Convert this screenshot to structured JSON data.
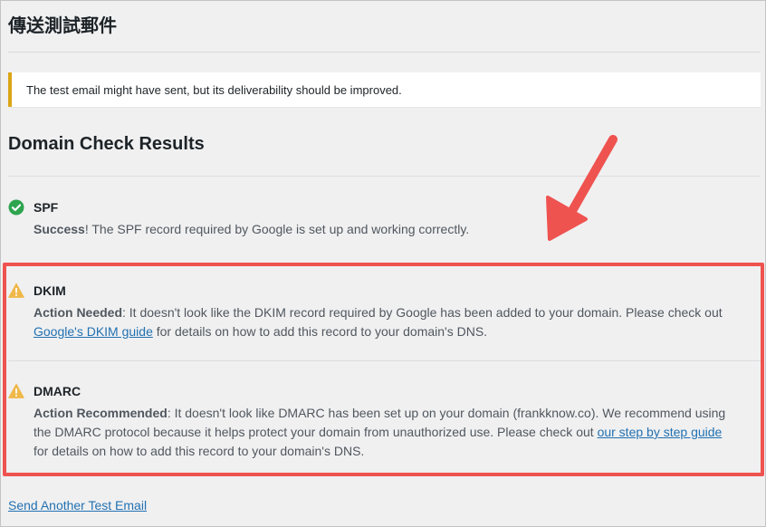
{
  "page": {
    "title": "傳送測試郵件"
  },
  "notice": {
    "text": "The test email might have sent, but its deliverability should be improved.",
    "color": "#dba617"
  },
  "domain_check": {
    "heading": "Domain Check Results",
    "results": [
      {
        "name": "SPF",
        "status": "success",
        "icon": "check-circle-icon",
        "lines": [
          {
            "bold": "Success",
            "rest": "! The SPF record required by Google is set up and working correctly."
          }
        ]
      },
      {
        "name": "DKIM",
        "status": "warning",
        "icon": "warning-triangle-icon",
        "lines": [
          {
            "bold": "Action Needed",
            "rest": ": It doesn't look like the DKIM record required by Google has been added to your domain. Please check out"
          },
          {
            "link": "Google's DKIM guide",
            "rest": " for details on how to add this record to your domain's DNS."
          }
        ]
      },
      {
        "name": "DMARC",
        "status": "warning",
        "icon": "warning-triangle-icon",
        "lines": [
          {
            "bold": "Action Recommended",
            "rest": ": It doesn't look like DMARC has been set up on your domain (frankknow.co). We recommend using"
          },
          {
            "pre": "the DMARC protocol because it helps protect your domain from unauthorized use. Please check out ",
            "link": "our step by step guide"
          },
          {
            "rest": "for details on how to add this record to your domain's DNS."
          }
        ]
      }
    ]
  },
  "footer": {
    "link": "Send Another Test Email"
  },
  "colors": {
    "success": "#2ea44f",
    "warning": "#f0b849",
    "highlight": "#ef5350",
    "link": "#2271b1"
  }
}
